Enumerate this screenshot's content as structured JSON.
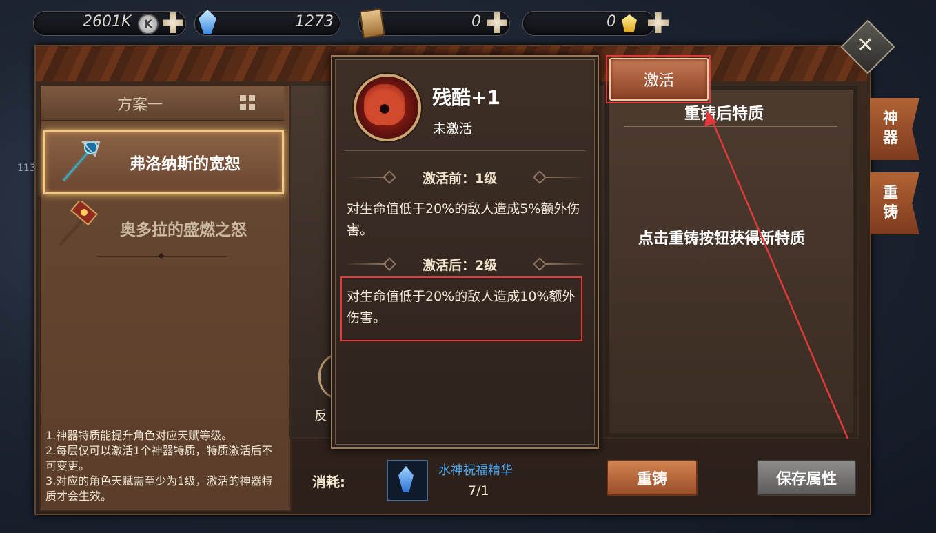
{
  "currency": {
    "silver": "2601K",
    "silver_icon_letter": "K",
    "diamonds": "1273",
    "cards": "0",
    "gold": "0"
  },
  "left_panel": {
    "plan_title": "方案一",
    "artifacts": [
      {
        "name": "弗洛纳斯的宽恕",
        "selected": true
      },
      {
        "name": "奥多拉的盛燃之怒",
        "selected": false
      }
    ],
    "hints": [
      "1.神器特质能提升角色对应天赋等级。",
      "2.每层仅可以激活1个神器特质，特质激活后不可变更。",
      "3.对应的角色天赋需至少为1级，激活的神器特质才会生效。"
    ]
  },
  "popup": {
    "talent_name": "残酷+1",
    "status": "未激活",
    "before_title": "激活前：1级",
    "before_desc": "对生命值低于20%的敌人造成5%额外伤害。",
    "after_title": "激活后：2级",
    "after_desc": "对生命值低于20%的敌人造成10%额外伤害。"
  },
  "right_panel": {
    "activate_label": "激活",
    "title": "重铸后特质",
    "message": "点击重铸按钮获得新特质"
  },
  "side_tabs": [
    "神器",
    "重铸"
  ],
  "bottom": {
    "cost_label": "消耗:",
    "item_name": "水神祝福精华",
    "item_count": "7/1",
    "recast_label": "重铸",
    "save_label": "保存属性"
  },
  "partial": {
    "hidden_label": "反",
    "edge_number": "113"
  },
  "colors": {
    "highlight_red": "#e23a3a",
    "link_blue": "#4aa6f0"
  }
}
